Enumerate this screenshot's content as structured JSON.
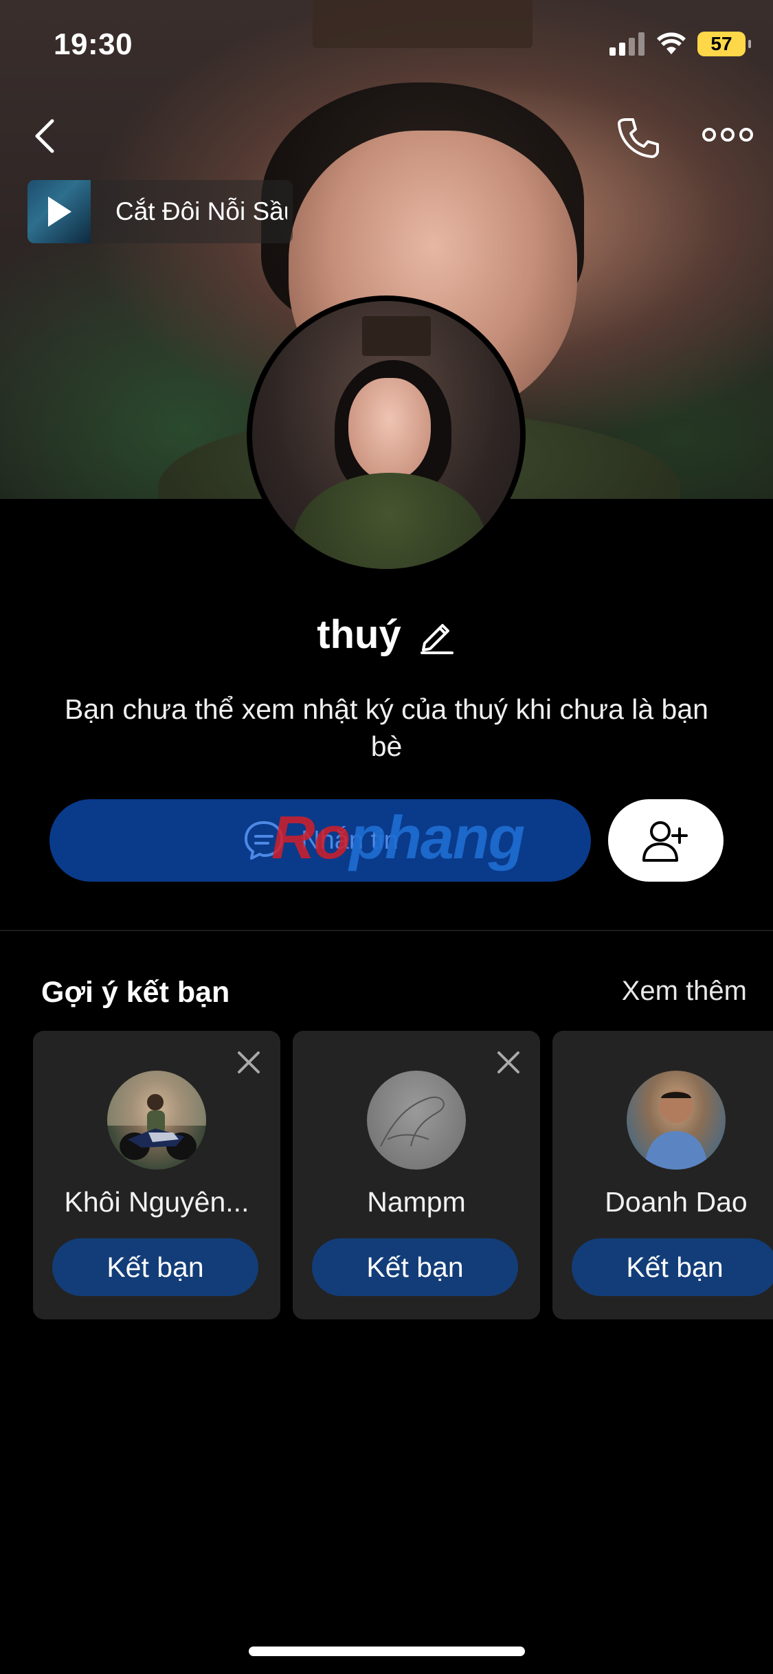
{
  "status_bar": {
    "time": "19:30",
    "battery": "57"
  },
  "music": {
    "title": "Cắt Đôi Nỗi Sầu"
  },
  "profile": {
    "name": "thuý",
    "notice": "Bạn chưa thể xem nhật ký của thuý khi chưa là bạn bè"
  },
  "actions": {
    "message_label": "Nhắn tin"
  },
  "watermark": {
    "part1": "Ro",
    "part2": "phang"
  },
  "suggestions": {
    "title": "Gợi ý kết bạn",
    "see_more": "Xem thêm",
    "items": [
      {
        "name": "Khôi Nguyên...",
        "button": "Kết bạn"
      },
      {
        "name": "Nampm",
        "button": "Kết bạn"
      },
      {
        "name": "Doanh Dao",
        "button": "Kết bạn"
      }
    ]
  },
  "colors": {
    "background": "#000000",
    "primary_button": "#0a3a8a",
    "friend_button": "#133d78",
    "card": "#232323",
    "battery": "#ffd84a"
  }
}
